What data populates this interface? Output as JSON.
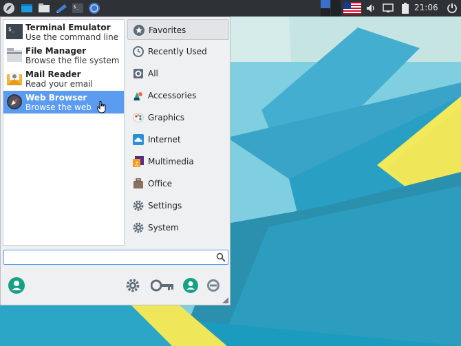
{
  "panel": {
    "launchers": [
      {
        "icon": "whisker-menu-icon"
      },
      {
        "icon": "show-desktop-icon"
      },
      {
        "icon": "file-manager-icon"
      },
      {
        "icon": "mail-icon"
      },
      {
        "icon": "terminal-icon"
      },
      {
        "icon": "web-browser-icon"
      }
    ],
    "workspaces_count": 4,
    "keyboard_layout_icon": "us-flag-icon",
    "clock": "21:06",
    "colors": {
      "panel_bg": "#2e3237",
      "accent": "#5b9bf0"
    }
  },
  "menu": {
    "favorites": [
      {
        "name": "Terminal Emulator",
        "desc": "Use the command line",
        "icon": "terminal-icon"
      },
      {
        "name": "File Manager",
        "desc": "Browse the file system",
        "icon": "file-manager-icon"
      },
      {
        "name": "Mail Reader",
        "desc": "Read your email",
        "icon": "mail-icon"
      },
      {
        "name": "Web Browser",
        "desc": "Browse the web",
        "icon": "web-browser-icon",
        "selected": true
      }
    ],
    "categories": [
      {
        "label": "Favorites",
        "icon": "star-icon",
        "active": true
      },
      {
        "label": "Recently Used",
        "icon": "clock-icon"
      },
      {
        "label": "All",
        "icon": "all-icon"
      },
      {
        "label": "Accessories",
        "icon": "accessories-icon"
      },
      {
        "label": "Graphics",
        "icon": "graphics-icon"
      },
      {
        "label": "Internet",
        "icon": "cloud-icon"
      },
      {
        "label": "Multimedia",
        "icon": "multimedia-icon"
      },
      {
        "label": "Office",
        "icon": "briefcase-icon"
      },
      {
        "label": "Settings",
        "icon": "gear-icon"
      },
      {
        "label": "System",
        "icon": "gear-icon"
      }
    ],
    "search": {
      "value": "",
      "placeholder": ""
    },
    "bottom_buttons": [
      "user-icon",
      "settings-icon",
      "lock-icon",
      "switch-user-icon",
      "logout-icon"
    ]
  }
}
